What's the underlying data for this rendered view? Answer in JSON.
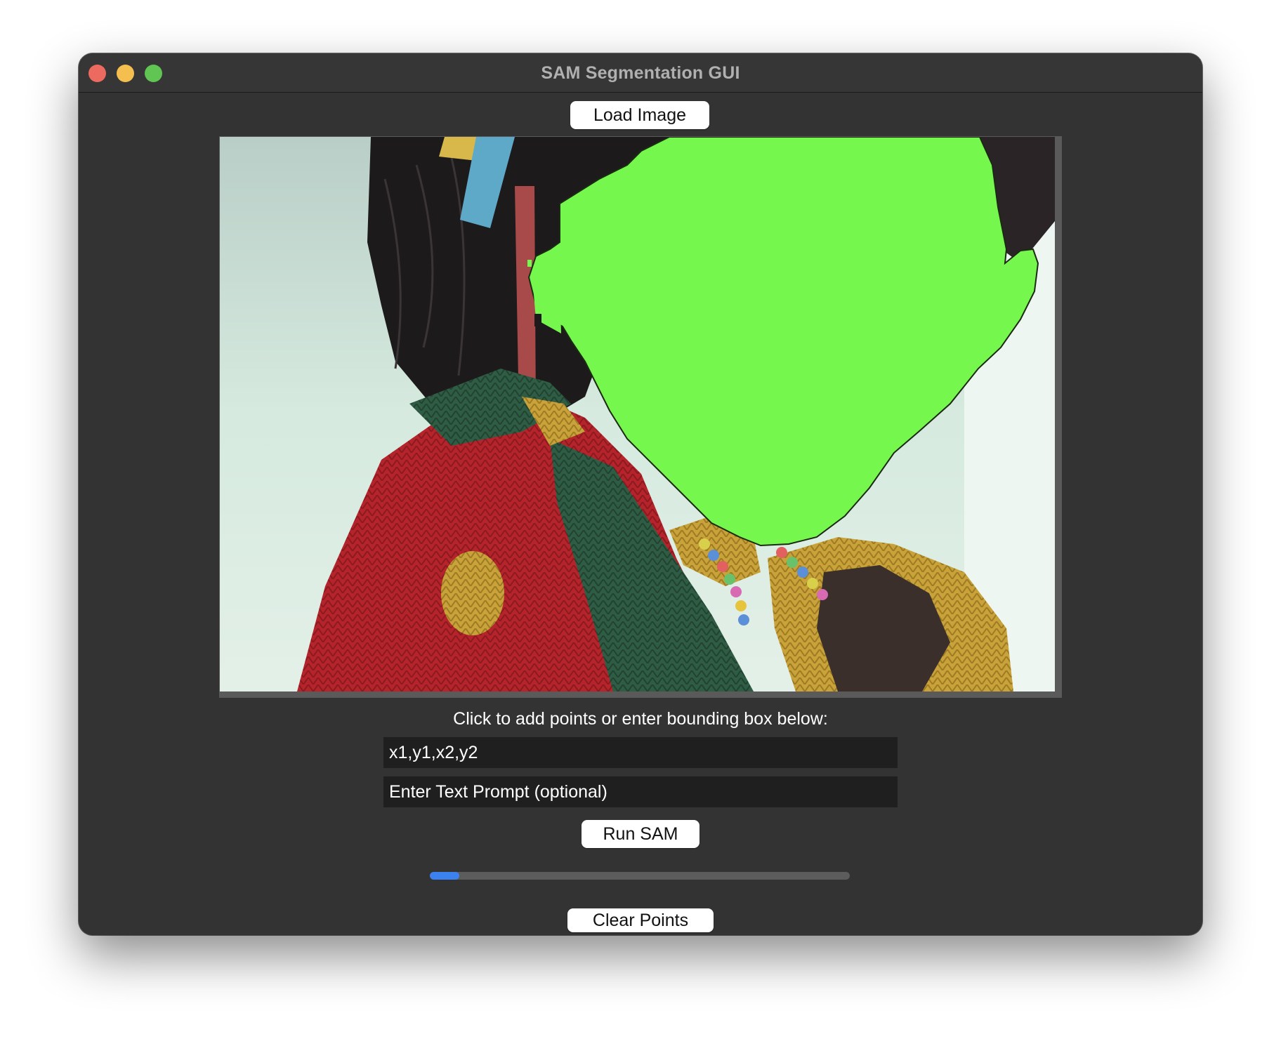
{
  "window": {
    "title": "SAM Segmentation GUI"
  },
  "toolbar": {
    "load_label": "Load Image"
  },
  "image": {
    "description": "Portrait photo of child in red knit sweater with face segmented by green mask",
    "mask_color": "#76f74d"
  },
  "controls": {
    "instruction": "Click to add points or enter bounding box below:",
    "bbox_placeholder": "x1,y1,x2,y2",
    "prompt_placeholder": "Enter Text Prompt (optional)",
    "run_label": "Run SAM",
    "progress": 0.07,
    "clear_label": "Clear Points"
  },
  "colors": {
    "accent": "#3b82f0",
    "window_bg": "#333333",
    "field_bg": "#1f1f1f"
  }
}
